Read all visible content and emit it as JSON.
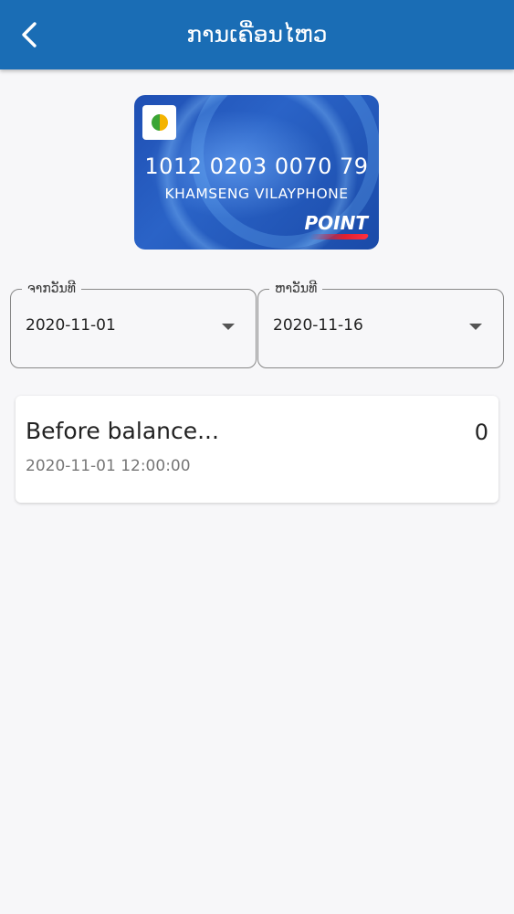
{
  "header": {
    "title": "ການເຄື່ອນໄຫວ",
    "back_icon": "chevron-left-icon"
  },
  "card": {
    "logo_icon": "soukxay-ecard-logo",
    "number": "1012 0203 0070 79",
    "holder_name": "KHAMSENG VILAYPHONE",
    "brand": "POINT"
  },
  "filters": {
    "from": {
      "label": "ຈາກວັນທີ",
      "value": "2020-11-01"
    },
    "to": {
      "label": "ຫາວັນທີ",
      "value": "2020-11-16"
    }
  },
  "transactions": [
    {
      "title": "Before balance...",
      "amount": "0",
      "datetime": "2020-11-01 12:00:00"
    }
  ],
  "colors": {
    "appbar": "#1a6db5",
    "background": "#f7f7f9",
    "card_blue": "#1f4fb3"
  }
}
